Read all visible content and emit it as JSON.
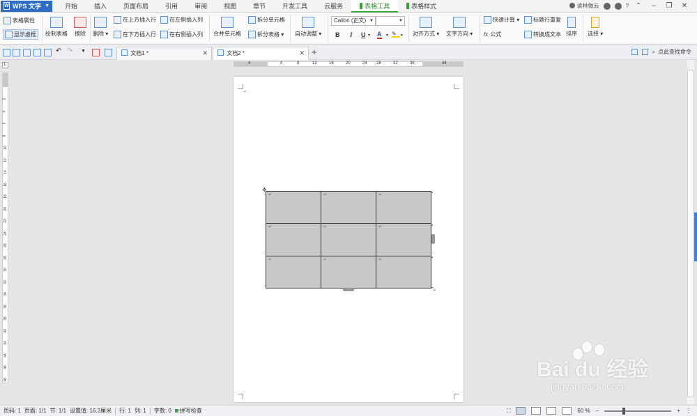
{
  "app": {
    "name": "WPS 文字"
  },
  "menu_tabs": [
    "开始",
    "插入",
    "页面布局",
    "引用",
    "审阅",
    "视图",
    "章节",
    "开发工具",
    "云服务",
    "表格工具",
    "表格样式"
  ],
  "active_menu_tab": "表格工具",
  "title_right": {
    "cloud": "读林做云"
  },
  "ribbon": {
    "table_props": "表格属性",
    "show_gridlines": "显示虚框",
    "draw_table": "绘制表格",
    "erase": "擦除",
    "delete": "删除",
    "insert_row_above": "在上方插入行",
    "insert_row_below": "在下方插入行",
    "insert_col_left": "在左侧插入列",
    "insert_col_right": "在右侧插入列",
    "merge_cells": "合并单元格",
    "split_cells": "拆分单元格",
    "split_table": "拆分表格",
    "auto_fit": "自动调整",
    "font_name": "Calibri (正文)",
    "font_size": "",
    "bold": "B",
    "italic": "I",
    "underline": "U",
    "font_color": "A",
    "align": "对齐方式",
    "text_direction": "文字方向",
    "quick_calc": "快速计算",
    "formula": "公式",
    "repeat_header": "标题行重复",
    "convert_text": "转换成文本",
    "sort": "排序",
    "select": "选择"
  },
  "doc_tabs": [
    {
      "label": "文档1 *"
    },
    {
      "label": "文档2 *"
    }
  ],
  "find_command": "点此查找命令",
  "ruler": {
    "labels": [
      "4",
      "4",
      "8",
      "12",
      "16",
      "20",
      "24",
      "28",
      "32",
      "36",
      "44"
    ]
  },
  "vruler": {
    "labels": [
      "2",
      "4",
      "6",
      "8",
      "10",
      "12",
      "14",
      "16",
      "18",
      "20",
      "22",
      "24",
      "26",
      "28",
      "30",
      "32",
      "34",
      "36",
      "38",
      "40",
      "42",
      "44",
      "46",
      "48"
    ]
  },
  "table": {
    "rows": 3,
    "cols": 3,
    "cell_mark": "↵",
    "fill_color": "#c8c8c8"
  },
  "status": {
    "page_num": "页码: 1",
    "pages": "页面: 1/1",
    "section": "节: 1/1",
    "setting": "设置值: 16.3厘米",
    "row": "行: 1",
    "col": "列: 1",
    "words": "字数: 0",
    "spell": "拼写检查",
    "zoom": "60 %"
  },
  "watermark": {
    "brand": "Bai du 经验",
    "url": "jingyan.baidu.com"
  },
  "colors": {
    "accent_blue": "#2f6cc6",
    "active_green": "#3aa13a"
  }
}
